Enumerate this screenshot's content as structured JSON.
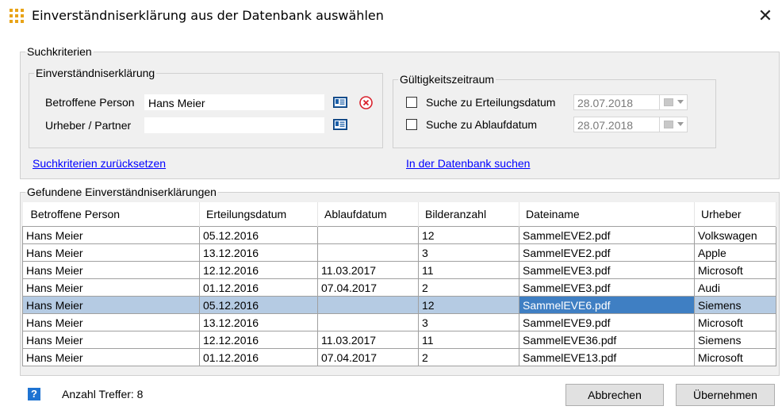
{
  "window": {
    "title": "Einverständniserklärung aus der Datenbank auswählen",
    "close_glyph": "✕",
    "app_icon": "grid-dots-icon"
  },
  "search": {
    "group_title": "Suchkriterien",
    "consent": {
      "group_title": "Einverständniserklärung",
      "person_label": "Betroffene Person",
      "person_value": "Hans Meier",
      "author_label": "Urheber / Partner",
      "author_value": ""
    },
    "validity": {
      "group_title": "Gültigkeitszeitraum",
      "issue_label": "Suche zu Erteilungsdatum",
      "issue_checked": false,
      "issue_date": "28.07.2018",
      "expiry_label": "Suche zu Ablaufdatum",
      "expiry_checked": false,
      "expiry_date": "28.07.2018"
    },
    "reset_link": "Suchkriterien zurücksetzen",
    "search_link": "In der Datenbank suchen"
  },
  "results": {
    "group_title": "Gefundene Einverständniserklärungen",
    "columns": [
      "Betroffene Person",
      "Erteilungsdatum",
      "Ablaufdatum",
      "Bilderanzahl",
      "Dateiname",
      "Urheber"
    ],
    "rows": [
      [
        "Hans Meier",
        "05.12.2016",
        "",
        "12",
        "SammelEVE2.pdf",
        "Volkswagen"
      ],
      [
        "Hans Meier",
        "13.12.2016",
        "",
        "3",
        "SammelEVE2.pdf",
        "Apple"
      ],
      [
        "Hans Meier",
        "12.12.2016",
        "11.03.2017",
        "11",
        "SammelEVE3.pdf",
        "Microsoft"
      ],
      [
        "Hans Meier",
        "01.12.2016",
        "07.04.2017",
        "2",
        "SammelEVE3.pdf",
        "Audi"
      ],
      [
        "Hans Meier",
        "05.12.2016",
        "",
        "12",
        "SammelEVE6.pdf",
        "Siemens"
      ],
      [
        "Hans Meier",
        "13.12.2016",
        "",
        "3",
        "SammelEVE9.pdf",
        "Microsoft"
      ],
      [
        "Hans Meier",
        "12.12.2016",
        "11.03.2017",
        "11",
        "SammelEVE36.pdf",
        "Siemens"
      ],
      [
        "Hans Meier",
        "01.12.2016",
        "07.04.2017",
        "2",
        "SammelEVE13.pdf",
        "Microsoft"
      ]
    ],
    "selected_row": 4,
    "active_column": 4
  },
  "footer": {
    "help_glyph": "?",
    "hits_text": "Anzahl Treffer: 8",
    "cancel_label": "Abbrechen",
    "accept_label": "Übernehmen"
  },
  "colors": {
    "accent": "#3f7fc3",
    "selection": "#b5cbe3",
    "link": "#0000ff",
    "icon_orange": "#e8a317"
  }
}
